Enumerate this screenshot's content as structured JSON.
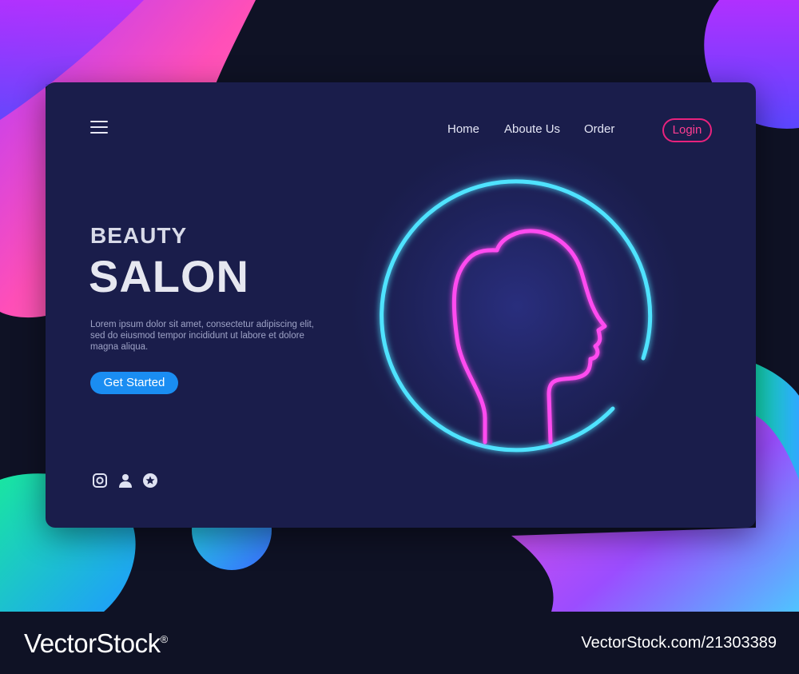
{
  "nav": {
    "menu_icon": "hamburger-menu-icon",
    "items": [
      {
        "label": "Home"
      },
      {
        "label": "Aboute Us"
      },
      {
        "label": "Order"
      }
    ],
    "login_label": "Login"
  },
  "hero": {
    "title_small": "BEAUTY",
    "title_large": "SALON",
    "description": "Lorem ipsum dolor sit amet, consectetur adipiscing elit, sed do eiusmod tempor incididunt ut labore et dolore magna aliqua.",
    "cta_label": "Get Started"
  },
  "social_icons": [
    "instagram-icon",
    "user-icon",
    "star-icon"
  ],
  "illustration": "neon-woman-head-profile-icon",
  "watermark": {
    "brand": "VectorStock",
    "registered": "®",
    "id": "VectorStock.com/21303389"
  },
  "colors": {
    "card": "#1a1d4b",
    "accent_pink": "#e8227d",
    "accent_blue": "#1a8df2",
    "neon_cyan": "#4fe3ff",
    "neon_magenta": "#ff4cf0"
  }
}
